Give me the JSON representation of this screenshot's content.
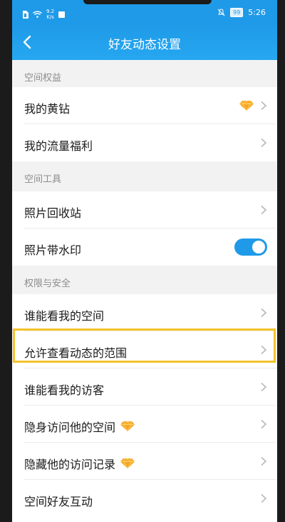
{
  "status_bar": {
    "speed_value": "9.2",
    "speed_unit": "K/s",
    "battery": "99",
    "time": "5:26"
  },
  "navbar": {
    "title": "好友动态设置",
    "back_icon": "chevron-left-icon"
  },
  "sections": [
    {
      "header": "空间权益",
      "items": [
        {
          "label": "我的黄钻",
          "accessory": "diamond-icon"
        },
        {
          "label": "我的流量福利"
        }
      ]
    },
    {
      "header": "空间工具",
      "items": [
        {
          "label": "照片回收站"
        },
        {
          "label": "照片带水印",
          "toggle": true
        }
      ]
    },
    {
      "header": "权限与安全",
      "items": [
        {
          "label": "谁能看我的空间"
        },
        {
          "label": "允许查看动态的范围",
          "highlighted": true
        },
        {
          "label": "谁能看我的访客"
        },
        {
          "label": "隐身访问他的空间",
          "badge": "diamond-icon"
        },
        {
          "label": "隐藏他的访问记录",
          "badge": "diamond-icon"
        },
        {
          "label": "空间好友互动"
        }
      ]
    }
  ],
  "colors": {
    "primary": "#1f9ae8",
    "highlight": "#f4c22b",
    "diamond": "#f5a623"
  }
}
